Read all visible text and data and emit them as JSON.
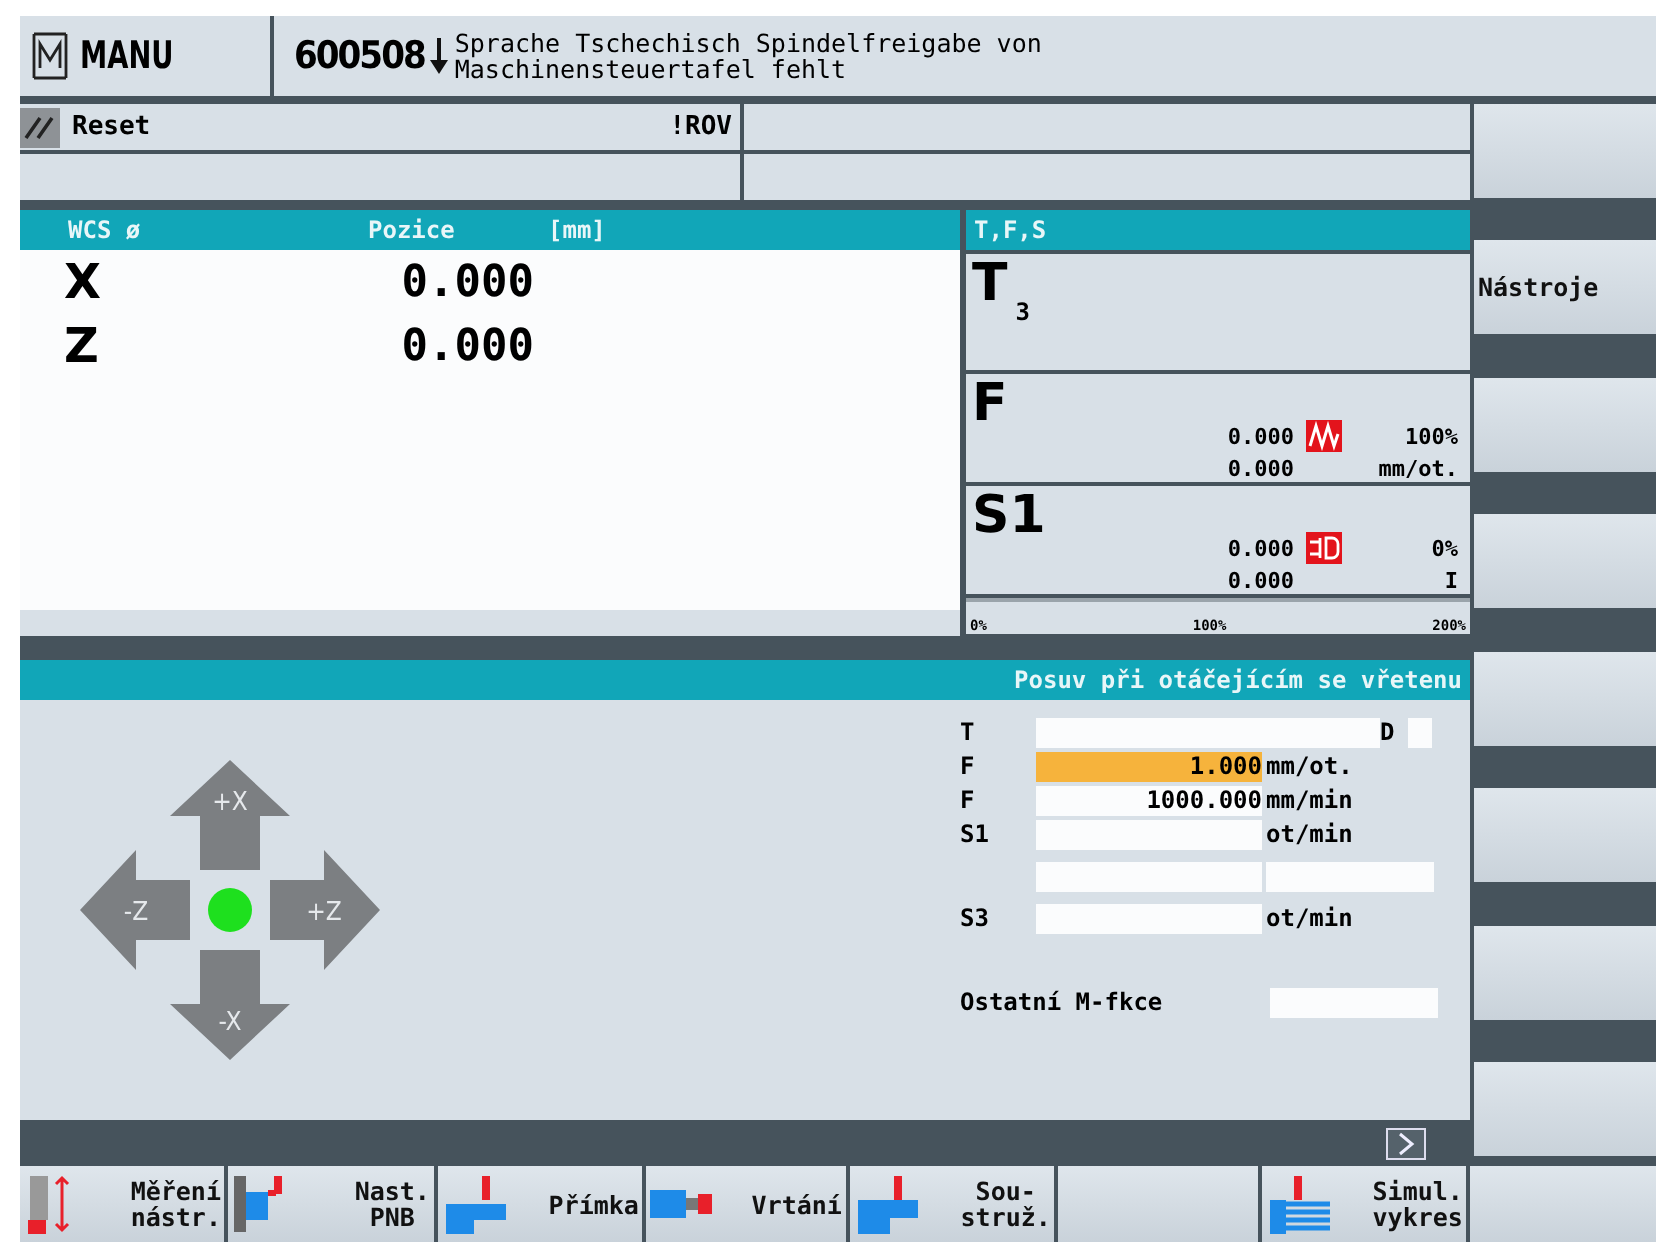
{
  "header": {
    "mode": "MANU",
    "alarm_number": "600508",
    "alarm_lines": [
      "Sprache Tschechisch Spindelfreigabe von",
      "Maschinensteuertafel fehlt"
    ]
  },
  "status": {
    "reset": "Reset",
    "override": "!ROV"
  },
  "position": {
    "columns": [
      "WCS ø",
      "Pozice",
      "[mm]"
    ],
    "axes": [
      {
        "axis": "X",
        "value": "0.000"
      },
      {
        "axis": "Z",
        "value": "0.000"
      }
    ]
  },
  "tfs": {
    "title": "T,F,S",
    "tool": {
      "letter": "T",
      "number": "3"
    },
    "feed": {
      "letter": "F",
      "values": [
        "0.000",
        "0.000"
      ],
      "percent": "100%",
      "unit": "mm/ot."
    },
    "spindle": {
      "letter": "S1",
      "values": [
        "0.000",
        "0.000"
      ],
      "percent": "0%",
      "unit": "I"
    },
    "scale": [
      "0%",
      "100%",
      "200%"
    ]
  },
  "form": {
    "title": "Posuv při otáčejícím se vřetenu",
    "jog": [
      "+X",
      "-Z",
      "+Z",
      "-X"
    ],
    "rows": [
      {
        "kind": "tool",
        "label": "T",
        "extra": "D"
      },
      {
        "kind": "value",
        "label": "F",
        "value": "1.000",
        "unit": "mm/ot.",
        "selected": true
      },
      {
        "kind": "value",
        "label": "F",
        "value": "1000.000",
        "unit": "mm/min",
        "selected": false
      },
      {
        "kind": "value",
        "label": "S1",
        "unit": "ot/min",
        "selected": false
      },
      {
        "kind": "double"
      },
      {
        "kind": "value",
        "label": "S3",
        "unit": "ot/min",
        "selected": false
      },
      {
        "kind": "gap"
      },
      {
        "kind": "mfunc",
        "label": "Ostatní M-fkce"
      }
    ]
  },
  "vertical_softkeys": [
    {
      "kind": "blank"
    },
    {
      "kind": "text",
      "label": "Nástroje"
    },
    {
      "kind": "blank"
    },
    {
      "kind": "blank"
    },
    {
      "kind": "blank"
    },
    {
      "kind": "blank"
    },
    {
      "kind": "blank"
    },
    {
      "kind": "blank"
    }
  ],
  "horizontal_softkeys": [
    {
      "kind": "text",
      "lines": [
        "Měření",
        "nástr."
      ]
    },
    {
      "kind": "text",
      "lines": [
        "Nast.",
        "PNB"
      ]
    },
    {
      "kind": "text",
      "lines": [
        "Přímka"
      ]
    },
    {
      "kind": "text",
      "lines": [
        "Vrtání"
      ]
    },
    {
      "kind": "text",
      "lines": [
        "Sou-",
        "struž."
      ]
    },
    {
      "kind": "blank"
    },
    {
      "kind": "text",
      "lines": [
        "Simul.",
        "vykres"
      ]
    },
    {
      "kind": "blank"
    }
  ]
}
